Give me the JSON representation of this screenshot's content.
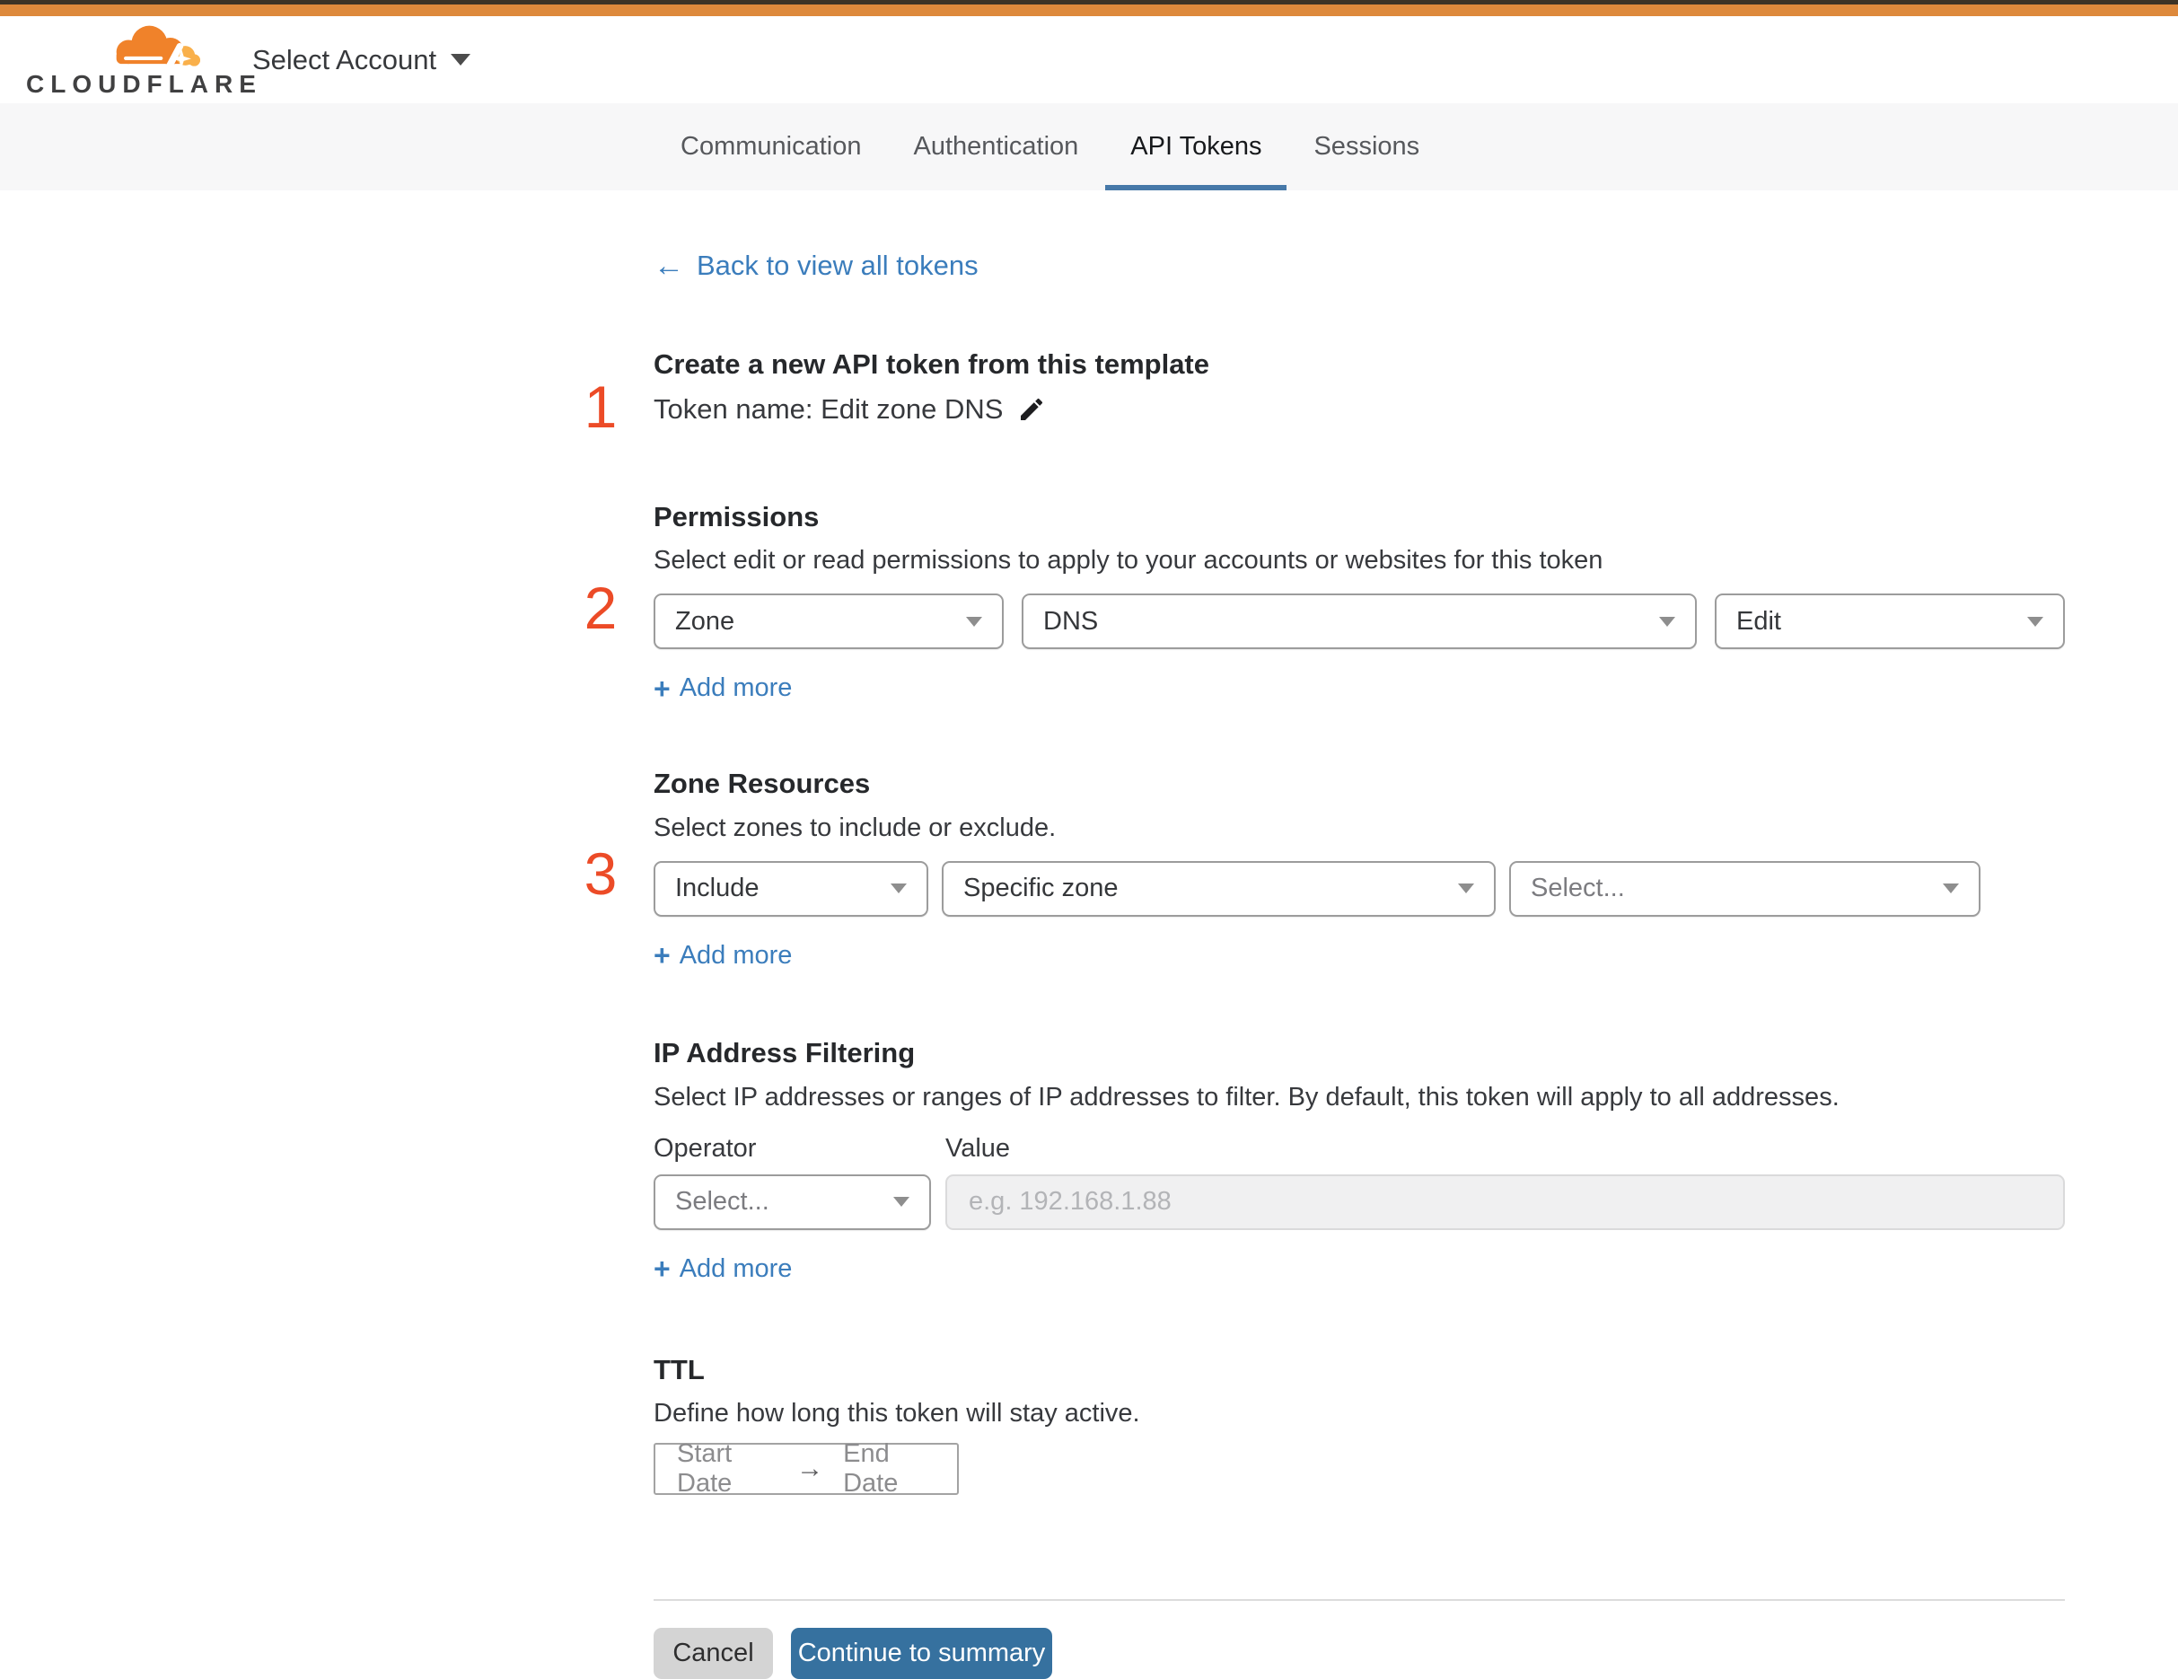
{
  "header": {
    "logo_text": "CLOUDFLARE",
    "account_selector": "Select Account"
  },
  "tabs": [
    {
      "label": "Communication",
      "active": false
    },
    {
      "label": "Authentication",
      "active": false
    },
    {
      "label": "API Tokens",
      "active": true
    },
    {
      "label": "Sessions",
      "active": false
    }
  ],
  "back_link": {
    "arrow": "←",
    "label": "Back to view all tokens"
  },
  "sections": {
    "token": {
      "number": "1",
      "title": "Create a new API token from this template",
      "token_name_line": "Token name: Edit zone DNS"
    },
    "permissions": {
      "number": "2",
      "title": "Permissions",
      "subtitle": "Select edit or read permissions to apply to your accounts or websites for this token",
      "dropdowns": [
        {
          "value": "Zone"
        },
        {
          "value": "DNS"
        },
        {
          "value": "Edit"
        }
      ],
      "add_more_plus": "+",
      "add_more_label": "Add more"
    },
    "zone_resources": {
      "number": "3",
      "title": "Zone Resources",
      "subtitle": "Select zones to include or exclude.",
      "dropdowns": [
        {
          "value": "Include"
        },
        {
          "value": "Specific zone"
        },
        {
          "value": "Select..."
        }
      ],
      "add_more_plus": "+",
      "add_more_label": "Add more"
    },
    "ip_filtering": {
      "title": "IP Address Filtering",
      "subtitle": "Select IP addresses or ranges of IP addresses to filter. By default, this token will apply to all addresses.",
      "operator_label": "Operator",
      "value_label": "Value",
      "operator_dropdown_value": "Select...",
      "value_placeholder": "e.g. 192.168.1.88",
      "add_more_plus": "+",
      "add_more_label": "Add more"
    },
    "ttl": {
      "title": "TTL",
      "subtitle": "Define how long this token will stay active.",
      "start_label": "Start Date",
      "range_arrow": "→",
      "end_label": "End Date"
    }
  },
  "footer": {
    "cancel_label": "Cancel",
    "continue_label": "Continue to summary"
  },
  "colors": {
    "top_bar_orange": "#dd893c",
    "brand_orange": "#f0822a",
    "brand_amber": "#f9b04b",
    "step_number_red": "#ec4b27",
    "link_blue": "#3b7dbc",
    "active_tab_underline": "#4779a9",
    "primary_button_blue": "#36719f"
  }
}
